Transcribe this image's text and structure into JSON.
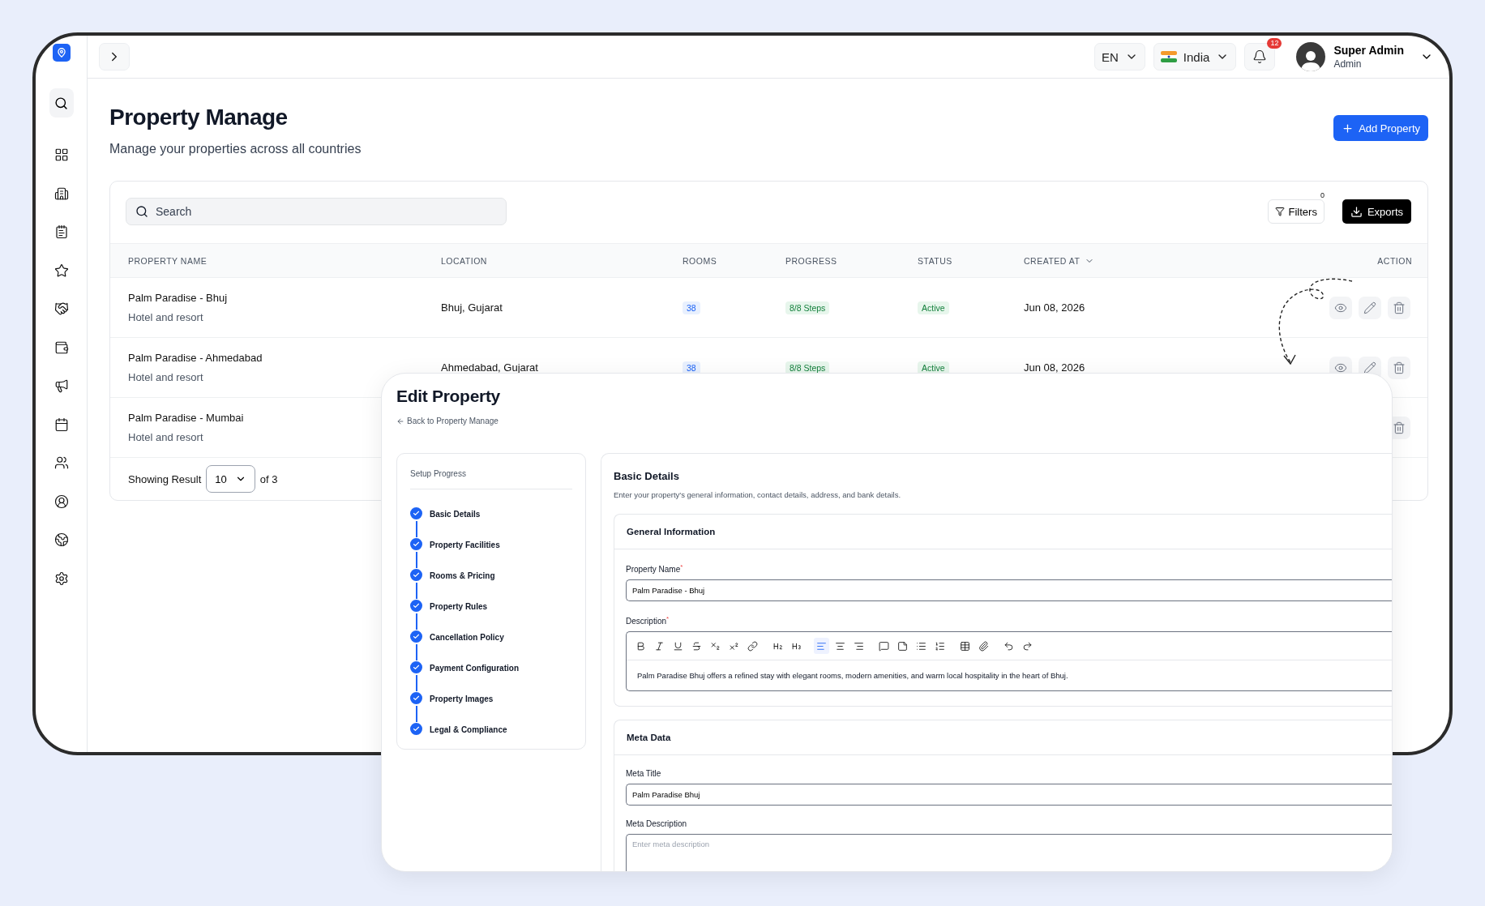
{
  "topbar": {
    "language": "EN",
    "country": "India",
    "notifications": "12",
    "user": {
      "name": "Super Admin",
      "role": "Admin"
    }
  },
  "page": {
    "title": "Property Manage",
    "subtitle": "Manage your properties across all countries",
    "add_button": "Add Property"
  },
  "table": {
    "search_placeholder": "Search",
    "filters": {
      "label": "Filters",
      "count": "0"
    },
    "exports": "Exports",
    "columns": [
      {
        "label": "PROPERTY NAME",
        "sortable": false
      },
      {
        "label": "LOCATION",
        "sortable": false
      },
      {
        "label": "ROOMS",
        "sortable": false
      },
      {
        "label": "PROGRESS",
        "sortable": false
      },
      {
        "label": "STATUS",
        "sortable": false
      },
      {
        "label": "CREATED AT",
        "sortable": true
      },
      {
        "label": "ACTION",
        "sortable": false
      }
    ],
    "rows": [
      {
        "name": "Palm Paradise - Bhuj",
        "type": "Hotel and resort",
        "location": "Bhuj, Gujarat",
        "rooms": "38",
        "progress": "8/8 Steps",
        "status": "Active",
        "created_at": "Jun 08, 2026",
        "actions": [
          {
            "kind": "view"
          },
          {
            "kind": "edit"
          },
          {
            "kind": "delete"
          }
        ]
      },
      {
        "name": "Palm Paradise - Ahmedabad",
        "type": "Hotel and resort",
        "location": "Ahmedabad, Gujarat",
        "rooms": "38",
        "progress": "8/8 Steps",
        "status": "Active",
        "created_at": "Jun 08, 2026",
        "actions": [
          {
            "kind": "view"
          },
          {
            "kind": "edit"
          },
          {
            "kind": "delete"
          }
        ]
      },
      {
        "name": "Palm Paradise - Mumbai",
        "type": "Hotel and resort",
        "actions": [
          {
            "kind": "delete"
          }
        ]
      }
    ],
    "footer": {
      "label": "Showing Result",
      "page_size": "10",
      "total": "of 3"
    }
  },
  "edit_panel": {
    "title": "Edit Property",
    "back_link": "Back to Property Manage",
    "progress_title": "Setup Progress",
    "steps": [
      {
        "label": "Basic Details",
        "done": true
      },
      {
        "label": "Property Facilities",
        "done": true
      },
      {
        "label": "Rooms & Pricing",
        "done": true
      },
      {
        "label": "Property Rules",
        "done": true
      },
      {
        "label": "Cancellation Policy",
        "done": true
      },
      {
        "label": "Payment Configuration",
        "done": true
      },
      {
        "label": "Property Images",
        "done": true
      },
      {
        "label": "Legal & Compliance",
        "done": true
      }
    ],
    "section_title": "Basic Details",
    "section_subtitle": "Enter your property's general information, contact details, address, and bank details.",
    "general": {
      "title": "General Information",
      "name_label": "Property Name$^{*}$",
      "name_value": "Palm Paradise - Bhuj",
      "description_label": "Description$^{*}$",
      "toolbar": [
        {
          "kind": "bold",
          "selected": false
        },
        {
          "kind": "italic",
          "selected": false
        },
        {
          "kind": "underline",
          "selected": false
        },
        {
          "kind": "strike",
          "selected": false
        },
        {
          "kind": "subscript",
          "selected": false
        },
        {
          "kind": "superscript",
          "selected": false
        },
        {
          "kind": "link",
          "selected": false
        },
        {
          "kind": "h2",
          "selected": false
        },
        {
          "kind": "h3",
          "selected": false
        },
        {
          "kind": "align-left",
          "selected": true
        },
        {
          "kind": "align-center",
          "selected": false
        },
        {
          "kind": "align-right",
          "selected": false
        },
        {
          "kind": "comment",
          "selected": false
        },
        {
          "kind": "note",
          "selected": false
        },
        {
          "kind": "bullet-list",
          "selected": false
        },
        {
          "kind": "ordered-list",
          "selected": false
        },
        {
          "kind": "table",
          "selected": false
        },
        {
          "kind": "attach",
          "selected": false
        },
        {
          "kind": "undo",
          "selected": false
        },
        {
          "kind": "redo",
          "selected": false
        }
      ],
      "description_value": "Palm Paradise Bhuj offers a refined stay with elegant rooms, modern amenities, and warm local hospitality in the heart of Bhuj."
    },
    "meta": {
      "title": "Meta Data",
      "title_label": "Meta Title",
      "title_value": "Palm Paradise Bhuj",
      "description_label": "Meta Description",
      "description_placeholder": "Enter meta description"
    }
  }
}
